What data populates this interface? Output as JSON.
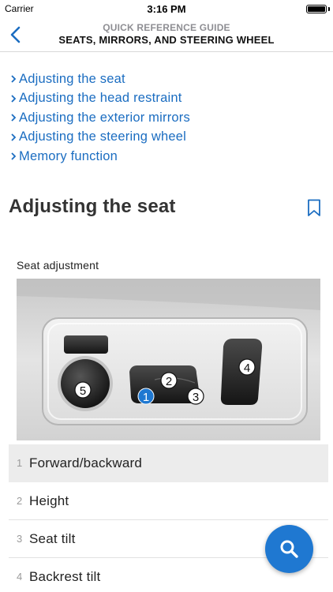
{
  "status": {
    "carrier": "Carrier",
    "time": "3:16 PM"
  },
  "nav": {
    "subtitle": "QUICK REFERENCE GUIDE",
    "title": "SEATS, MIRRORS, AND STEERING WHEEL"
  },
  "toc": [
    {
      "label": "Adjusting the seat"
    },
    {
      "label": "Adjusting the head restraint"
    },
    {
      "label": "Adjusting the exterior mirrors"
    },
    {
      "label": "Adjusting the steering wheel"
    },
    {
      "label": "Memory function"
    }
  ],
  "section": {
    "title": "Adjusting the seat"
  },
  "figure": {
    "caption": "Seat adjustment",
    "markers": [
      "1",
      "2",
      "3",
      "4",
      "5"
    ]
  },
  "list": [
    {
      "num": "1",
      "text": "Forward/backward"
    },
    {
      "num": "2",
      "text": "Height"
    },
    {
      "num": "3",
      "text": "Seat tilt"
    },
    {
      "num": "4",
      "text": "Backrest tilt"
    }
  ],
  "colors": {
    "accent": "#1f78d1",
    "link": "#1b6dc1"
  },
  "icons": [
    "back-chevron-icon",
    "bookmark-icon",
    "search-icon",
    "battery-icon"
  ]
}
